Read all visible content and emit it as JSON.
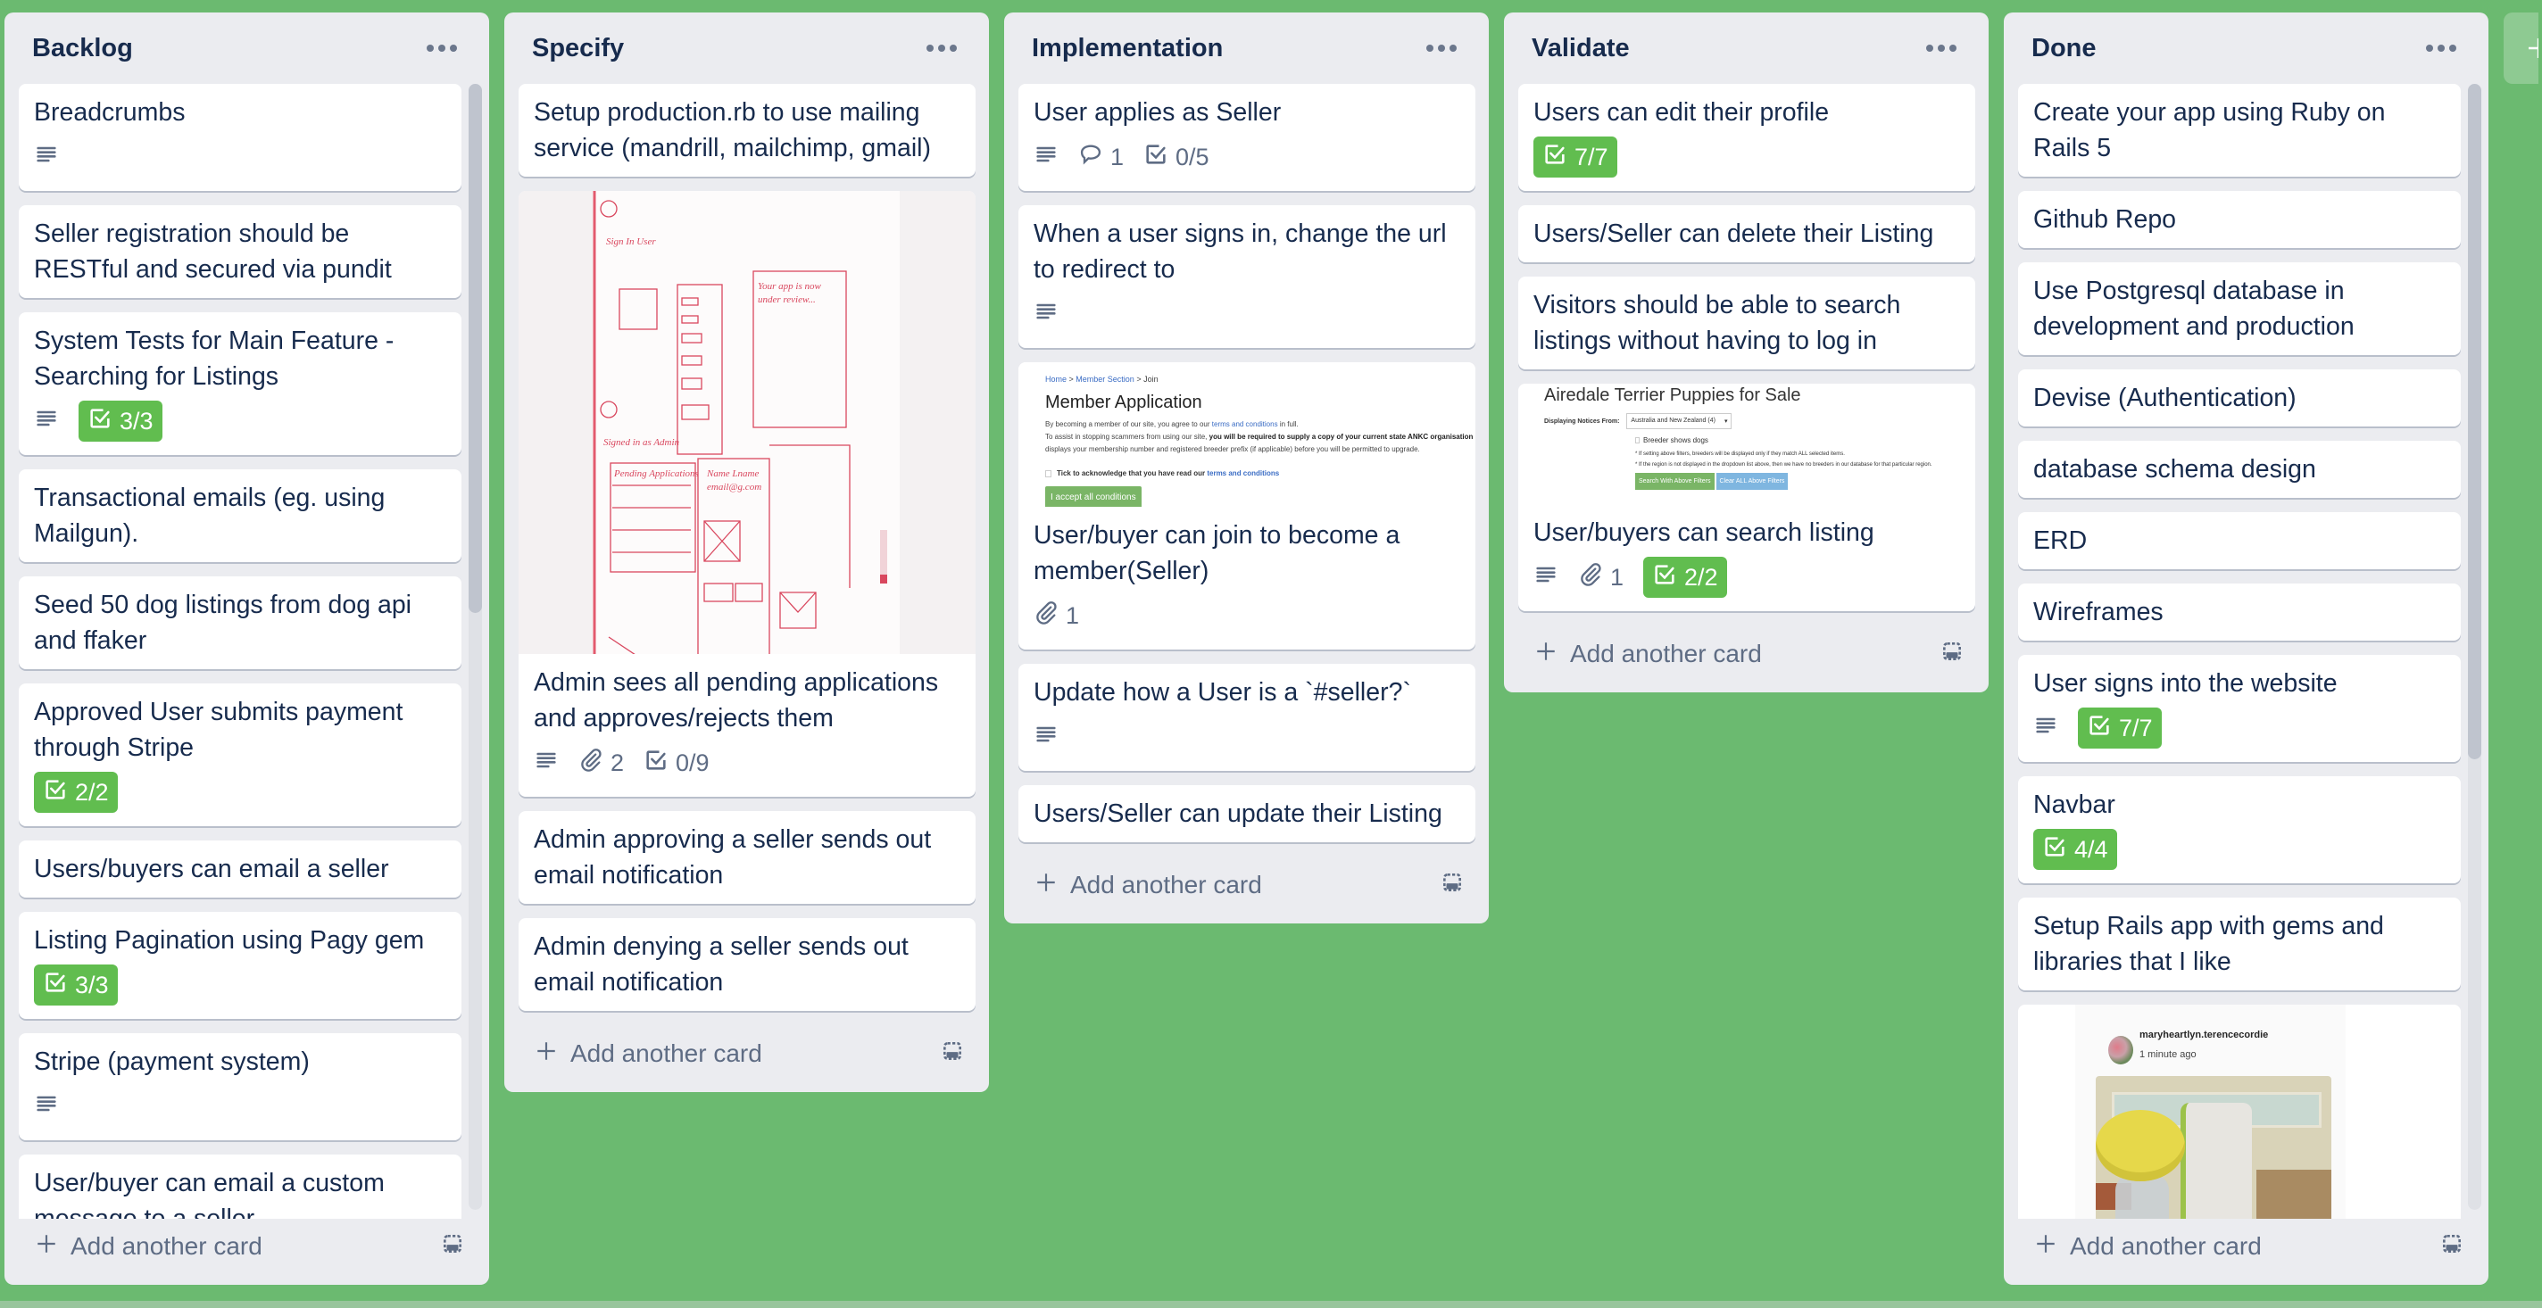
{
  "colors": {
    "background": "#6bba70",
    "list": "#ebecf0",
    "complete_badge": "#61bd4f",
    "text": "#172b4d",
    "muted": "#5e6c84"
  },
  "footer_label": "Add another card",
  "lists": [
    {
      "title": "Backlog",
      "scrolled": true,
      "scroll_fraction": 0.47,
      "cards": [
        {
          "title": "Breadcrumbs",
          "description": true
        },
        {
          "title": "Seller registration should be RESTful and secured via pundit"
        },
        {
          "title": "System Tests for Main Feature - Searching for Listings",
          "description": true,
          "checklist": "3/3",
          "checklist_complete": true
        },
        {
          "title": "Transactional emails (eg. using Mailgun)."
        },
        {
          "title": "Seed 50 dog listings from dog api and ffaker"
        },
        {
          "title": "Approved User submits payment through Stripe",
          "checklist": "2/2",
          "checklist_complete": true
        },
        {
          "title": "Users/buyers can email a seller"
        },
        {
          "title": "Listing Pagination using Pagy gem",
          "checklist": "3/3",
          "checklist_complete": true
        },
        {
          "title": "Stripe (payment system)",
          "description": true
        },
        {
          "title": "User/buyer can email a custom message to a seller"
        }
      ]
    },
    {
      "title": "Specify",
      "cards": [
        {
          "title": "Setup production.rb to use mailing service (mandrill, mailchimp, gmail)"
        },
        {
          "cover": "sketch",
          "title": "Admin sees all pending applications and approves/rejects them",
          "description": true,
          "attachments": "2",
          "checklist": "0/9"
        },
        {
          "title": "Admin approving a seller sends out email notification"
        },
        {
          "title": "Admin denying a seller sends out email notification"
        }
      ]
    },
    {
      "title": "Implementation",
      "cards": [
        {
          "title": "User applies as Seller",
          "description": true,
          "comments": "1",
          "checklist": "0/5"
        },
        {
          "title": "When a user signs in, change the url to redirect to",
          "description": true
        },
        {
          "cover": "member",
          "title": "User/buyer can join to become a member(Seller)",
          "attachments": "1"
        },
        {
          "title": "Update how a User is a `#seller?`",
          "description": true
        },
        {
          "title": "Users/Seller can update their Listing"
        }
      ]
    },
    {
      "title": "Validate",
      "cards": [
        {
          "title": "Users can edit their profile",
          "checklist": "7/7",
          "checklist_complete": true
        },
        {
          "title": "Users/Seller can delete their Listing"
        },
        {
          "title": "Visitors should be able to search listings without having to log in"
        },
        {
          "cover": "airedale",
          "title": "User/buyers can search listing",
          "description": true,
          "attachments": "1",
          "checklist": "2/2",
          "checklist_complete": true
        }
      ]
    },
    {
      "title": "Done",
      "scrolled": true,
      "scroll_fraction": 0.6,
      "cards": [
        {
          "title": "Create your app using Ruby on Rails 5"
        },
        {
          "title": "Github Repo"
        },
        {
          "title": "Use Postgresql database in development and production"
        },
        {
          "title": "Devise (Authentication)"
        },
        {
          "title": "database schema design"
        },
        {
          "title": "ERD"
        },
        {
          "title": "Wireframes"
        },
        {
          "title": "User signs into the website",
          "description": true,
          "checklist": "7/7",
          "checklist_complete": true
        },
        {
          "title": "Navbar",
          "checklist": "4/4",
          "checklist_complete": true
        },
        {
          "title": "Setup Rails app with gems and libraries that I like"
        },
        {
          "cover": "post"
        }
      ]
    }
  ],
  "covers": {
    "member": {
      "breadcrumb": [
        "Home",
        "Member Section",
        "Join"
      ],
      "title": "Member Application",
      "p1_pre": "By becoming a member of our site, you agree to our ",
      "p1_link": "terms and conditions",
      "p1_post": " in full.",
      "p2_pre": "To assist in stopping scammers from using our site, ",
      "p2_bold": "you will be required to supply a copy of your current state ANKC organisation memb",
      "p3": "displays your membership number and registered breeder prefix (if applicable) before you will be permitted to upgrade.",
      "tick_pre": "Tick to acknowledge that you have read our ",
      "tick_link": "terms and conditions",
      "button": "I accept all conditions"
    },
    "airedale": {
      "title": "Airedale Terrier Puppies for Sale",
      "label": "Displaying Notices From:",
      "select": "Australia and New Zealand (4)",
      "checkbox": "Breeder shows dogs",
      "note1": "* If setting above filters, breeders will be displayed only if they match ALL selected items.",
      "note2": "* If the region is not displayed in the dropdown list above, then we have no breeders in our database for that particular region.",
      "search_button": "Search With Above Filters",
      "clear_button": "Clear ALL Above Filters"
    },
    "post": {
      "username": "maryheartlyn.terencecordie",
      "time": "1 minute ago"
    }
  }
}
